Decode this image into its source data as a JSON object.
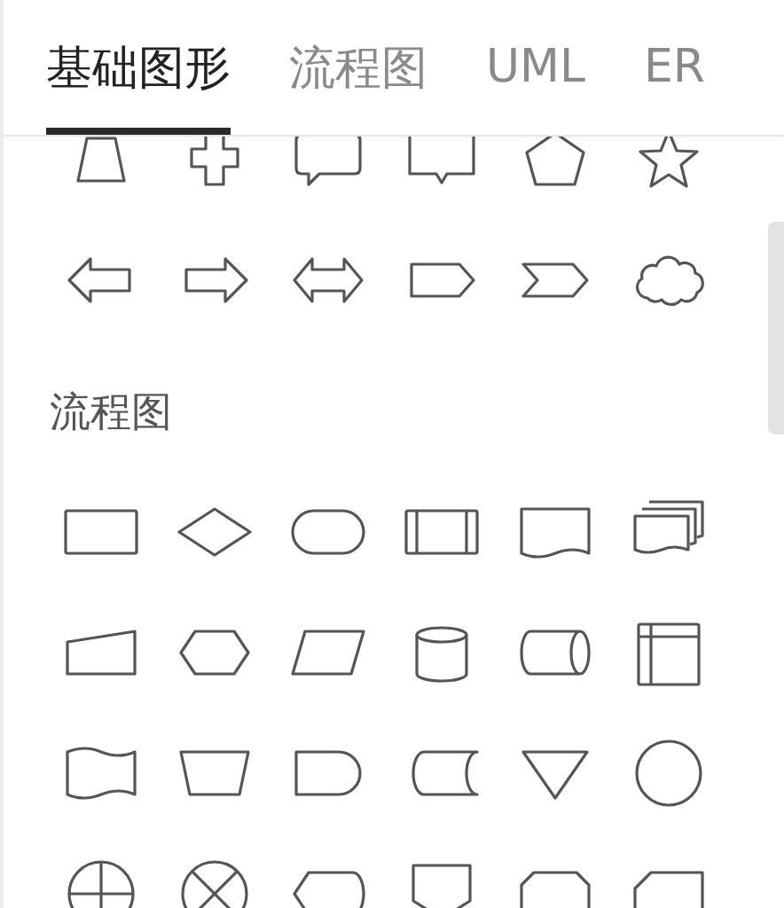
{
  "tabs": [
    {
      "label": "基础图形",
      "selected": true
    },
    {
      "label": "流程图",
      "selected": false
    },
    {
      "label": "UML",
      "selected": false
    },
    {
      "label": "ER",
      "selected": false
    }
  ],
  "flowchart_section": {
    "heading": "流程图"
  }
}
